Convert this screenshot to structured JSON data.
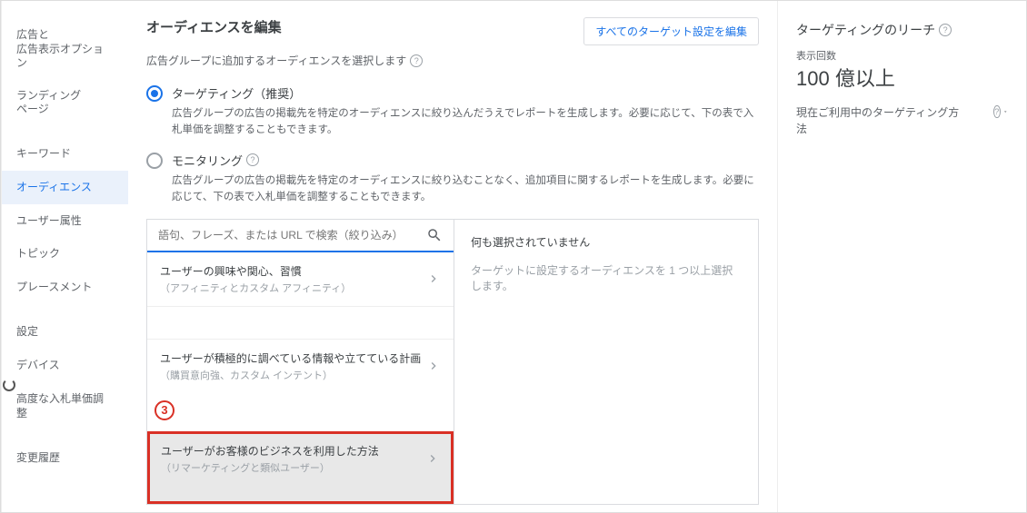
{
  "sidebar": {
    "items": [
      {
        "label": "広告と\n広告表示オプション"
      },
      {
        "label": "ランディング\nページ"
      },
      {
        "label": "キーワード"
      },
      {
        "label": "オーディエンス"
      },
      {
        "label": "ユーザー属性"
      },
      {
        "label": "トピック"
      },
      {
        "label": "プレースメント"
      },
      {
        "label": "設定"
      },
      {
        "label": "デバイス"
      },
      {
        "label": "高度な入札単価調整"
      },
      {
        "label": "変更履歴"
      }
    ]
  },
  "main": {
    "title": "オーディエンスを編集",
    "edit_all_label": "すべてのターゲット設定を編集",
    "subtitle": "広告グループに追加するオーディエンスを選択します",
    "radios": [
      {
        "label": "ターゲティング（推奨）",
        "desc": "広告グループの広告の掲載先を特定のオーディエンスに絞り込んだうえでレポートを生成します。必要に応じて、下の表で入札単価を調整することもできます。"
      },
      {
        "label": "モニタリング",
        "desc": "広告グループの広告の掲載先を特定のオーディエンスに絞り込むことなく、追加項目に関するレポートを生成します。必要に応じて、下の表で入札単価を調整することもできます。"
      }
    ],
    "search_placeholder": "語句、フレーズ、または URL で検索（絞り込み）",
    "categories": [
      {
        "title": "ユーザーの興味や関心、習慣",
        "sub": "（アフィニティとカスタム アフィニティ）"
      },
      {
        "title": "ユーザーが積極的に調べている情報や立てている計画",
        "sub": "（購買意向強、カスタム インテント）"
      },
      {
        "title": "ユーザーがお客様のビジネスを利用した方法",
        "sub": "（リマーケティングと類似ユーザー）"
      }
    ],
    "empty_label": "何も選択されていません",
    "empty_hint": "ターゲットに設定するオーディエンスを 1 つ以上選択します。",
    "marker": "3"
  },
  "reach": {
    "title": "ターゲティングのリーチ",
    "impressions_label": "表示回数",
    "impressions_value": "100 億以上",
    "current_desc": "現在ご利用中のターゲティング方法"
  }
}
